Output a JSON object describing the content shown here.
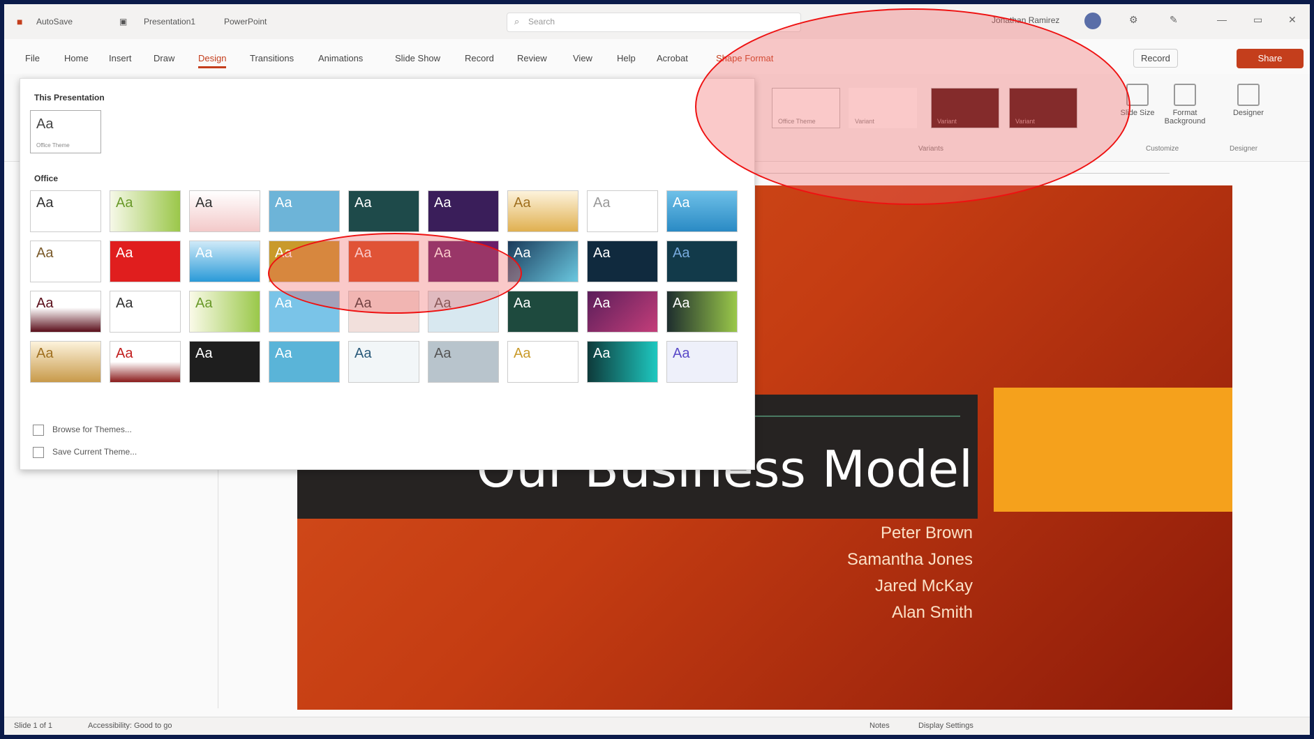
{
  "titlebar": {
    "autosave": "AutoSave",
    "filename": "Presentation1",
    "app": "PowerPoint",
    "search_placeholder": "Search",
    "user": "Jonathan Ramirez"
  },
  "tabs": [
    "File",
    "Home",
    "Insert",
    "Draw",
    "Design",
    "Transitions",
    "Animations",
    "Slide Show",
    "Record",
    "Review",
    "View",
    "Help",
    "Acrobat",
    "Shape Format"
  ],
  "active_tab": "Design",
  "record_label": "Record",
  "share_label": "Share",
  "ribbon": {
    "variants": [
      "Office Theme",
      "Variant",
      "Variant",
      "Variant"
    ],
    "variants_group": "Variants",
    "customize_buttons": [
      "Slide Size",
      "Format Background"
    ],
    "customize_group": "Customize",
    "designer_button": "Designer",
    "designer_group": "Designer"
  },
  "dropdown": {
    "this_presentation_title": "This Presentation",
    "current_theme_name": "Office Theme",
    "office_title": "Office",
    "browse_label": "Browse for Themes...",
    "save_label": "Save Current Theme..."
  },
  "theme_sample": "Aa",
  "slide": {
    "title": "Our Business Model",
    "presenters": [
      "Peter Brown",
      "Samantha Jones",
      "Jared McKay",
      "Alan Smith"
    ]
  },
  "statusbar": {
    "slide_info": "Slide 1 of 1",
    "accessibility": "Accessibility: Good to go",
    "notes": "Notes",
    "display_settings": "Display Settings"
  },
  "colors": {
    "accent": "#c43e1c",
    "highlight": "#e11111"
  }
}
